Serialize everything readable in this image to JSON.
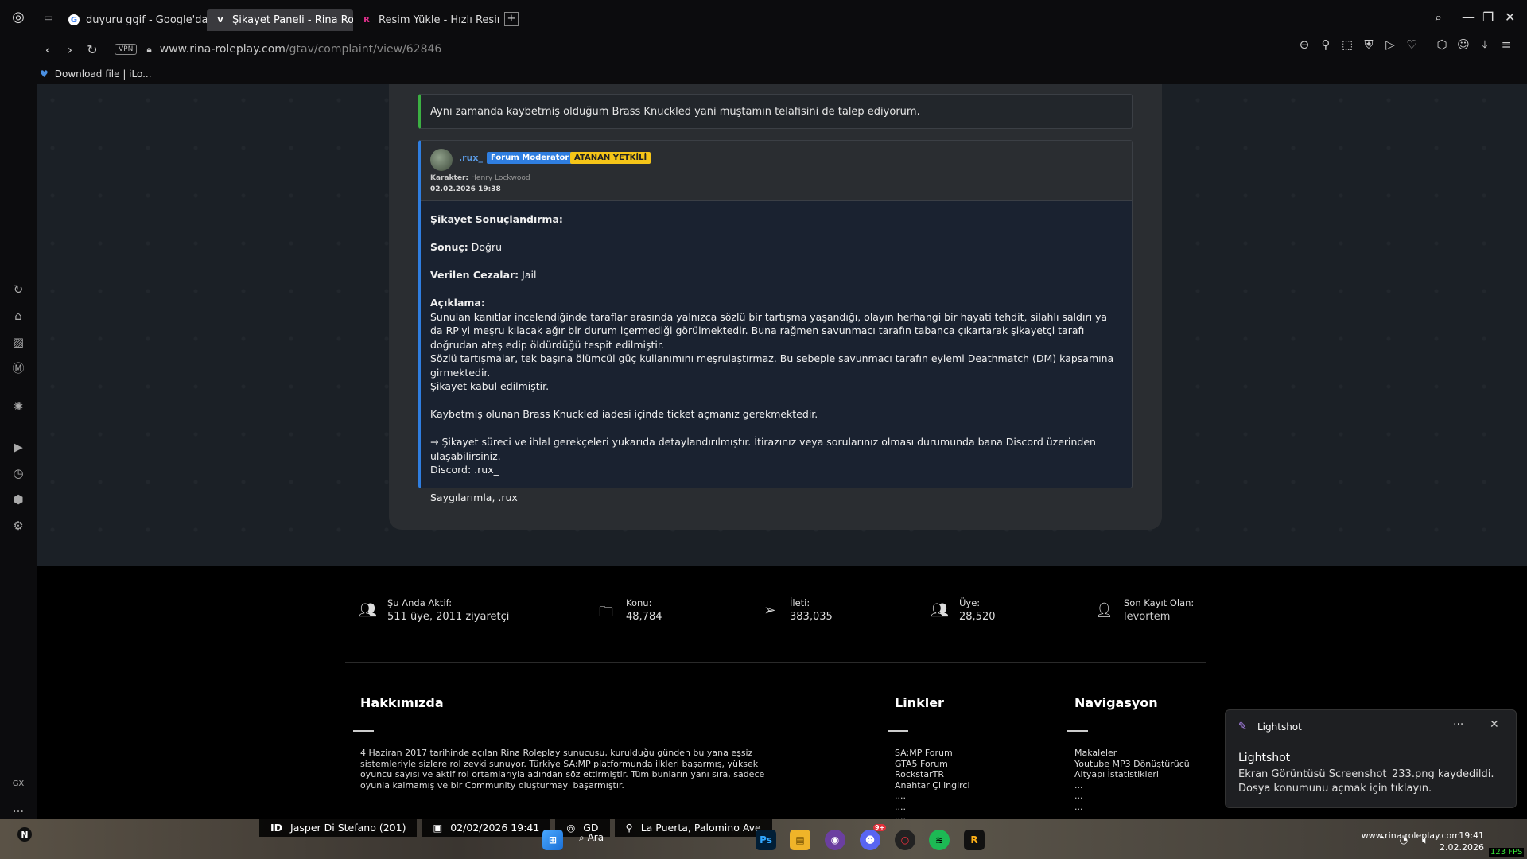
{
  "browser": {
    "tabs": [
      {
        "label": "duyuru ggif - Google'da Ar",
        "favicon": "G",
        "color": "#4285f4"
      },
      {
        "label": "Şikayet Paneli - Rina Rolep",
        "favicon": "V",
        "color": "#ffffff"
      },
      {
        "label": "Resim Yükle - Hızlı Resim",
        "favicon": "R",
        "color": "#e0308c"
      }
    ],
    "vpn_label": "VPN",
    "url_domain": "www.rina-roleplay.com",
    "url_path": "/gtav/complaint/view/62846",
    "bookmark": "Download file | iLo..."
  },
  "previous_message": "Aynı zamanda kaybetmiş olduğum Brass Knuckled yani muştamın telafisini de talep ediyorum.",
  "reply": {
    "username": ".rux_",
    "badge_mod": "Forum Moderator",
    "badge_assigned": "ATANAN YETKİLİ",
    "karakter_label": "Karakter:",
    "karakter_name": "Henry Lockwood",
    "date": "02.02.2026 19:38",
    "title": "Şikayet Sonuçlandırma:",
    "sonuc_label": "Sonuç:",
    "sonuc_value": "Doğru",
    "ceza_label": "Verilen Cezalar:",
    "ceza_value": "Jail",
    "aciklama_label": "Açıklama:",
    "aciklama_1": "Sunulan kanıtlar incelendiğinde taraflar arasında yalnızca sözlü bir tartışma yaşandığı, olayın herhangi bir hayati tehdit, silahlı saldırı ya da RP'yi meşru kılacak ağır bir durum içermediği görülmektedir. Buna rağmen savunmacı tarafın tabanca çıkartarak şikayetçi tarafı doğrudan ateş edip öldürdüğü tespit edilmiştir.",
    "aciklama_2": "Sözlü tartışmalar, tek başına ölümcül güç kullanımını meşrulaştırmaz. Bu sebeple savunmacı tarafın eylemi Deathmatch (DM) kapsamına girmektedir.",
    "aciklama_3": "Şikayet kabul edilmiştir.",
    "note": "Kaybetmiş olunan Brass Knuckled iadesi içinde ticket açmanız gerekmektedir.",
    "contact": "→ Şikayet süreci ve ihlal gerekçeleri yukarıda detaylandırılmıştır. İtirazınız veya sorularınız olması durumunda bana Discord üzerinden ulaşabilirsiniz.",
    "discord": "Discord: .rux_",
    "signoff": "Saygılarımla, .rux"
  },
  "stats": [
    {
      "label": "Şu Anda Aktif:",
      "value": "511 üye, 2011 ziyaretçi",
      "icon": "users-icon"
    },
    {
      "label": "Konu:",
      "value": "48,784",
      "icon": "folder-icon"
    },
    {
      "label": "İleti:",
      "value": "383,035",
      "icon": "send-icon"
    },
    {
      "label": "Üye:",
      "value": "28,520",
      "icon": "members-icon"
    },
    {
      "label": "Son Kayıt Olan:",
      "value": "levortem",
      "icon": "user-plus-icon"
    }
  ],
  "footer": {
    "about_title": "Hakkımızda",
    "about_text": "4 Haziran 2017 tarihinde açılan Rina Roleplay sunucusu, kurulduğu günden bu yana eşsiz sistemleriyle sizlere rol zevki sunuyor. Türkiye SA:MP platformunda ilkleri başarmış, yüksek oyuncu sayısı ve aktif rol ortamlarıyla adından söz ettirmiştir. Tüm bunların yanı sıra, sadece oyunla kalmamış ve bir Community oluşturmayı başarmıştır.",
    "links_title": "Linkler",
    "links": [
      "SA:MP Forum",
      "GTA5 Forum",
      "RockstarTR",
      "Anahtar Çilingirci",
      "....",
      "....",
      "...."
    ],
    "nav_title": "Navigasyon",
    "nav": [
      "Makaleler",
      "Youtube MP3 Dönüştürücü",
      "Altyapı İstatistikleri",
      "...",
      "...",
      "..."
    ]
  },
  "toast": {
    "app": "Lightshot",
    "title": "Lightshot",
    "message": "Ekran Görüntüsü Screenshot_233.png kaydedildi. Dosya konumunu açmak için tıklayın."
  },
  "hud": {
    "id": "ID",
    "player": "Jasper Di Stefano (201)",
    "datetime": "02/02/2026 19:41",
    "gd": "GD",
    "location": "La Puerta, Palomino Ave"
  },
  "taskbar": {
    "search": "Ara",
    "clock_site": "www.rina-roleplay.com",
    "clock_time": "19:41",
    "clock_date": "2.02.2026",
    "fps": "123 FPS",
    "discord_badge": "9+"
  },
  "sidebar_labels": {
    "gx": "GX",
    "more": "..."
  }
}
